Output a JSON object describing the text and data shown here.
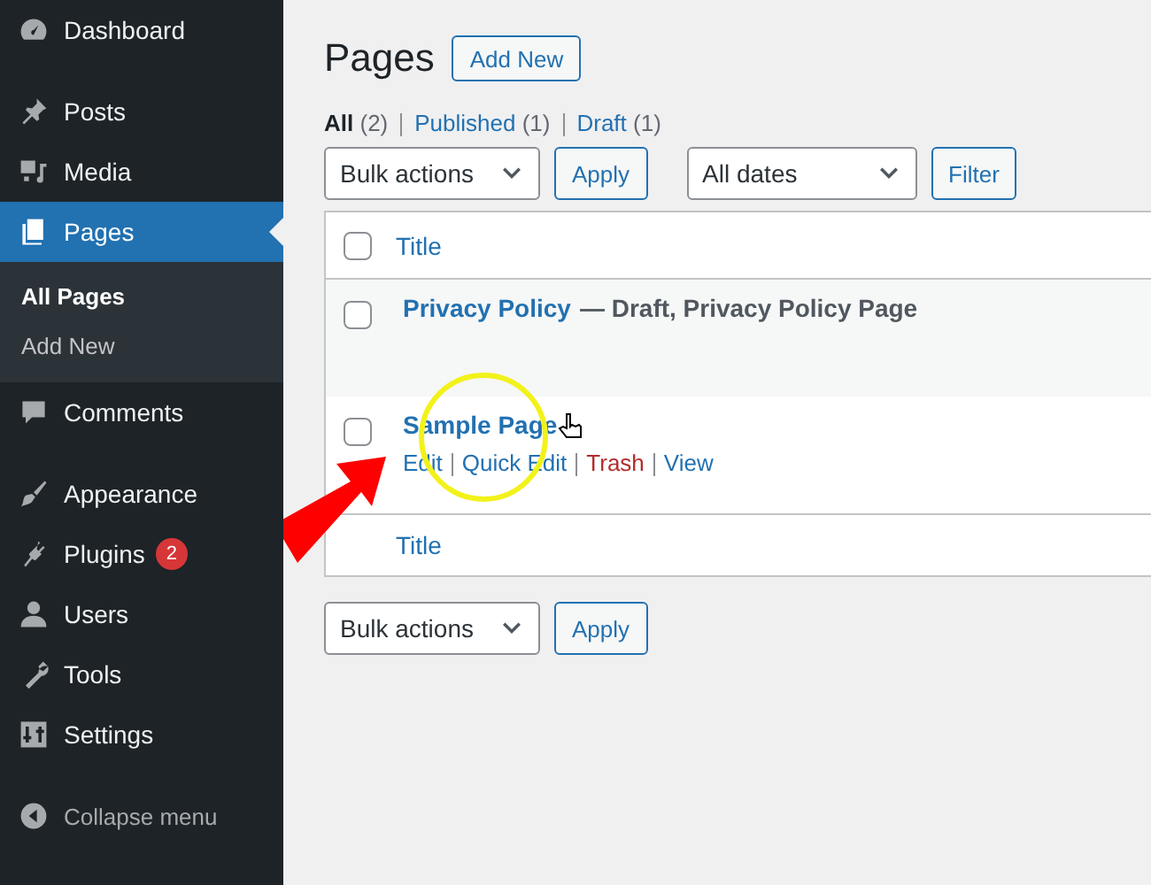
{
  "sidebar": {
    "groups": [
      [
        {
          "label": "Dashboard",
          "selected": false
        }
      ],
      [
        {
          "label": "Posts",
          "selected": false
        },
        {
          "label": "Media",
          "selected": false
        },
        {
          "label": "Pages",
          "selected": true,
          "children": [
            {
              "label": "All Pages",
              "selected": true
            },
            {
              "label": "Add New",
              "selected": false
            }
          ]
        },
        {
          "label": "Comments",
          "selected": false
        }
      ],
      [
        {
          "label": "Appearance",
          "selected": false
        },
        {
          "label": "Plugins",
          "selected": false,
          "badge": "2"
        },
        {
          "label": "Users",
          "selected": false
        },
        {
          "label": "Tools",
          "selected": false
        },
        {
          "label": "Settings",
          "selected": false
        }
      ]
    ],
    "collapse_label": "Collapse menu"
  },
  "main": {
    "title": "Pages",
    "add_new": "Add New",
    "filters": [
      {
        "label": "All",
        "count": "(2)",
        "selected": true
      },
      {
        "label": "Published",
        "count": "(1)",
        "selected": false
      },
      {
        "label": "Draft",
        "count": "(1)",
        "selected": false
      }
    ],
    "top_controls": {
      "bulk_actions": "Bulk actions",
      "apply": "Apply",
      "dates": "All dates",
      "filter": "Filter"
    },
    "table": {
      "columns": [
        "Title"
      ],
      "select_all_checked": false,
      "rows": [
        {
          "title": "Privacy Policy",
          "state": "— Draft, Privacy Policy Page",
          "checked": false
        },
        {
          "title": "Sample Page",
          "checked": false,
          "actions": [
            {
              "label": "Edit",
              "kind": "link"
            },
            {
              "label": "Quick Edit",
              "kind": "link"
            },
            {
              "label": "Trash",
              "kind": "delete"
            },
            {
              "label": "View",
              "kind": "link"
            }
          ]
        }
      ],
      "footer_columns": [
        "Title"
      ]
    },
    "bottom_controls": {
      "bulk_actions": "Bulk actions",
      "apply": "Apply"
    }
  }
}
